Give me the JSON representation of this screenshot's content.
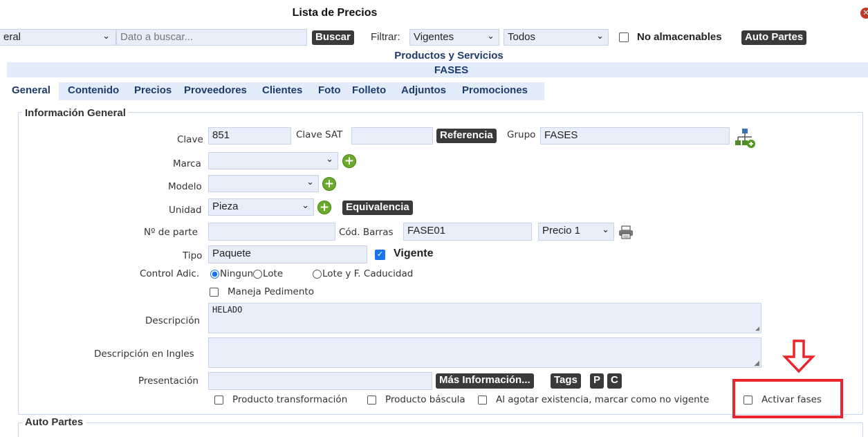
{
  "window": {
    "title": "Lista de Precios",
    "close_icon": "close-circle-icon"
  },
  "toolbar": {
    "category_select": "eral",
    "search_placeholder": "Dato a buscar...",
    "search_button": "Buscar",
    "filter_label": "Filtrar:",
    "filter_status": "Vigentes",
    "filter_scope": "Todos",
    "no_stock_label": "No almacenables",
    "autoparts_button": "Auto Partes"
  },
  "header": {
    "section": "Productos y Servicios",
    "product": "FASES"
  },
  "tabs": [
    "General",
    "Contenido",
    "Precios",
    "Proveedores",
    "Clientes",
    "Foto",
    "Folleto",
    "Adjuntos",
    "Promociones"
  ],
  "general": {
    "legend": "Información General",
    "clave_label": "Clave",
    "clave_value": "851",
    "clave_sat_label": "Clave SAT",
    "clave_sat_value": "",
    "referencia_button": "Referencia",
    "grupo_label": "Grupo",
    "grupo_value": "FASES",
    "marca_label": "Marca",
    "marca_value": "",
    "modelo_label": "Modelo",
    "modelo_value": "",
    "unidad_label": "Unidad",
    "unidad_value": "Pieza",
    "equivalencia_button": "Equivalencia",
    "parte_label": "Nº de parte",
    "parte_value": "",
    "barras_label": "Cód. Barras",
    "barras_value": "FASE01",
    "precio_select": "Precio 1",
    "tipo_label": "Tipo",
    "tipo_value": "Paquete",
    "vigente_label": "Vigente",
    "vigente_checked": true,
    "control_label": "Control Adic.",
    "control_options": [
      "Ninguno",
      "Lote",
      "Lote y F. Caducidad"
    ],
    "control_selected": "Ninguno",
    "pedimento_label": "Maneja Pedimento",
    "descripcion_label": "Descripción",
    "descripcion_value": "HELADO",
    "descripcion_en_label": "Descripción en Ingles",
    "descripcion_en_value": "",
    "presentacion_label": "Presentación",
    "presentacion_value": "",
    "mas_info_button": "Más Información...",
    "tags_button": "Tags",
    "p_button": "P",
    "c_button": "C",
    "transformacion_label": "Producto transformación",
    "bascula_label": "Producto báscula",
    "agotar_label": "Al agotar existencia, marcar como no vigente",
    "fases_label": "Activar fases"
  },
  "autopartes": {
    "legend": "Auto Partes"
  },
  "annotation": {
    "arrow_icon": "down-arrow-icon",
    "highlight_color": "#e8262b"
  }
}
